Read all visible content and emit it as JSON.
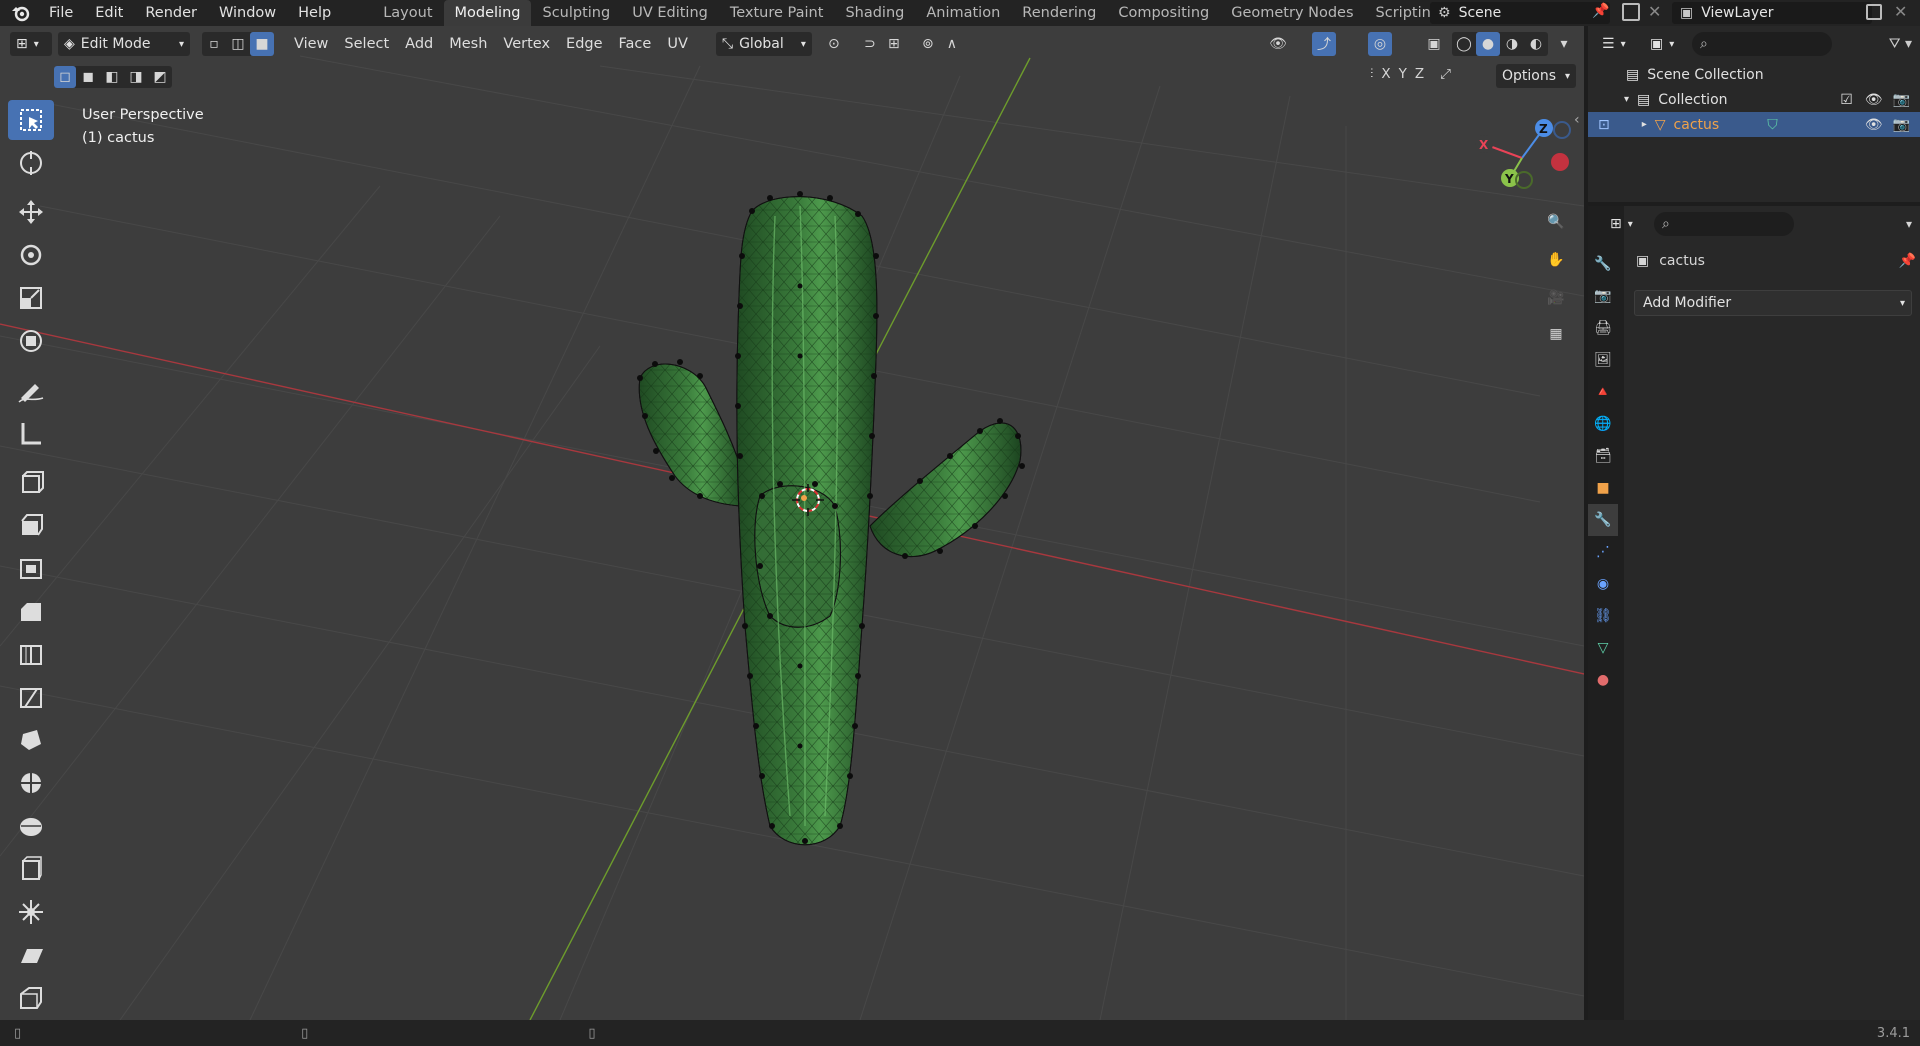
{
  "topbar": {
    "menus": [
      "File",
      "Edit",
      "Render",
      "Window",
      "Help"
    ],
    "workspaces": [
      "Layout",
      "Modeling",
      "Sculpting",
      "UV Editing",
      "Texture Paint",
      "Shading",
      "Animation",
      "Rendering",
      "Compositing",
      "Geometry Nodes",
      "Scripting"
    ],
    "active_workspace": "Modeling",
    "scene_name": "Scene",
    "view_layer_name": "ViewLayer"
  },
  "viewport": {
    "mode": "Edit Mode",
    "menus": [
      "View",
      "Select",
      "Add",
      "Mesh",
      "Vertex",
      "Edge",
      "Face",
      "UV"
    ],
    "orientation": "Global",
    "axis_labels": [
      "X",
      "Y",
      "Z"
    ],
    "options_label": "Options",
    "info_line1": "User Perspective",
    "info_line2": "(1) cactus",
    "gizmo_labels": {
      "x": "X",
      "y": "Y",
      "z": "Z"
    }
  },
  "outliner": {
    "items": [
      {
        "label": "Scene Collection"
      },
      {
        "label": "Collection"
      },
      {
        "label": "cactus"
      }
    ]
  },
  "properties": {
    "object_name": "cactus",
    "add_modifier_label": "Add Modifier"
  },
  "statusbar": {
    "version": "3.4.1"
  },
  "colors": {
    "selection": "#4772b3",
    "x_axis": "#e94357",
    "y_axis": "#8bc34a",
    "z_axis": "#4c8de6",
    "cactus": "#2e6a31",
    "cactus_highlight": "#5fae5e",
    "active_object": "#f0a24a"
  }
}
